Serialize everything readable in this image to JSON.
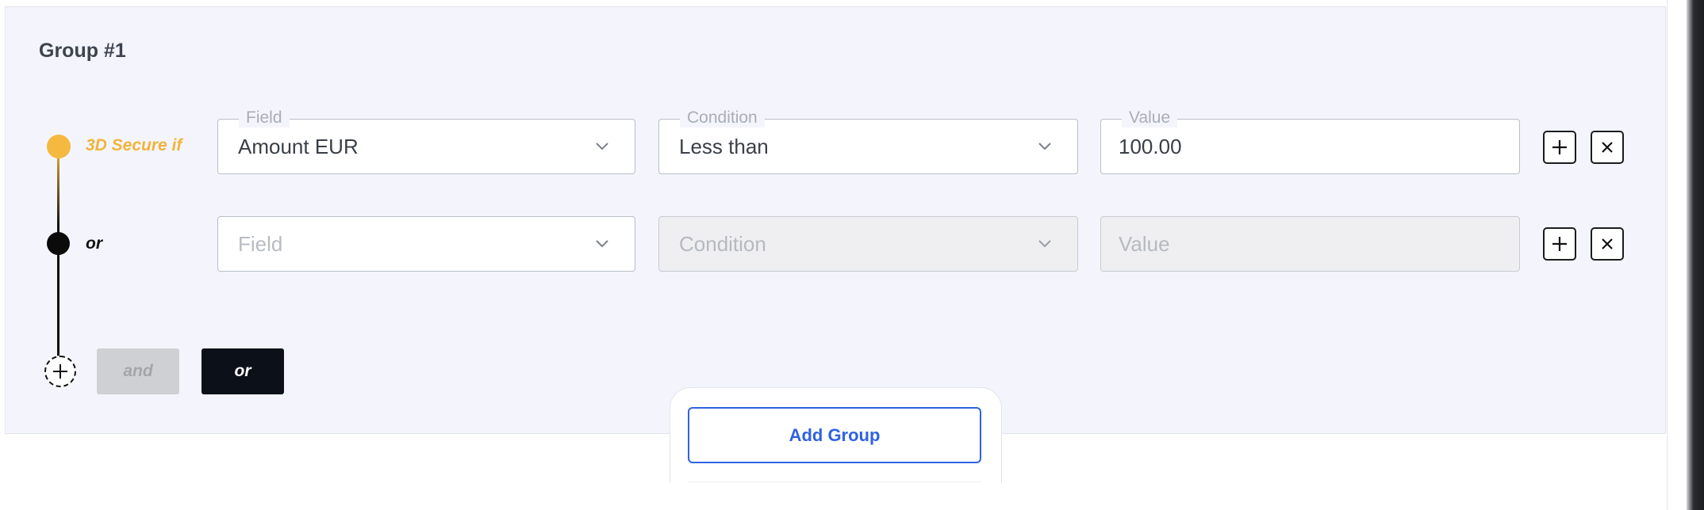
{
  "group": {
    "title": "Group #1"
  },
  "rules": [
    {
      "prefix": "3D Secure if",
      "prefix_color": "#f0b43c",
      "field": {
        "legend": "Field",
        "value": "Amount EUR"
      },
      "condition": {
        "legend": "Condition",
        "value": "Less than"
      },
      "value": {
        "legend": "Value",
        "value": "100.00"
      }
    },
    {
      "prefix": "or",
      "prefix_color": "#111111",
      "field": {
        "placeholder": "Field"
      },
      "condition": {
        "placeholder": "Condition"
      },
      "value": {
        "placeholder": "Value"
      }
    }
  ],
  "add_row": {
    "and_label": "and",
    "or_label": "or"
  },
  "add_group_label": "Add Group",
  "colors": {
    "accent": "#2f62e0",
    "gold": "#f4b93e"
  },
  "icons": {
    "plus": "plus-icon",
    "close": "close-icon",
    "chevron": "chevron-down-icon"
  }
}
